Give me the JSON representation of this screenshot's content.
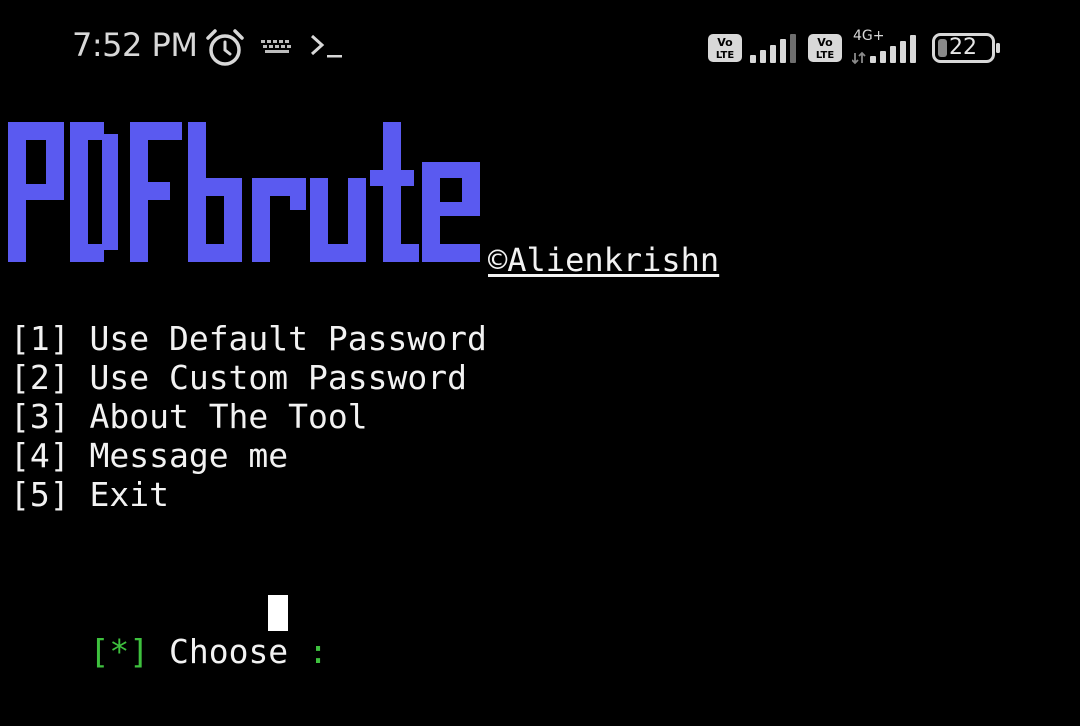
{
  "status_bar": {
    "time": "7:52 PM",
    "network_type": "4G+",
    "battery_level": "22",
    "icons": [
      "alarm-icon",
      "keyboard-icon",
      "terminal-icon",
      "volte-icon",
      "signal-icon",
      "volte-icon",
      "signal-icon",
      "battery-icon"
    ],
    "volte_label": "Vo LTE"
  },
  "banner": {
    "title": "PDFbrute",
    "title_color": "#5a5af0",
    "credit": "©Alienkrishn"
  },
  "menu": {
    "items": [
      {
        "key": "[1]",
        "label": "Use Default Password"
      },
      {
        "key": "[2]",
        "label": "Use Custom Password"
      },
      {
        "key": "[3]",
        "label": "About The Tool"
      },
      {
        "key": "[4]",
        "label": "Message me"
      },
      {
        "key": "[5]",
        "label": "Exit"
      }
    ]
  },
  "prompt": {
    "marker": "[*]",
    "label": "Choose",
    "separator": ":",
    "value": "",
    "marker_color": "#3ec13e"
  }
}
